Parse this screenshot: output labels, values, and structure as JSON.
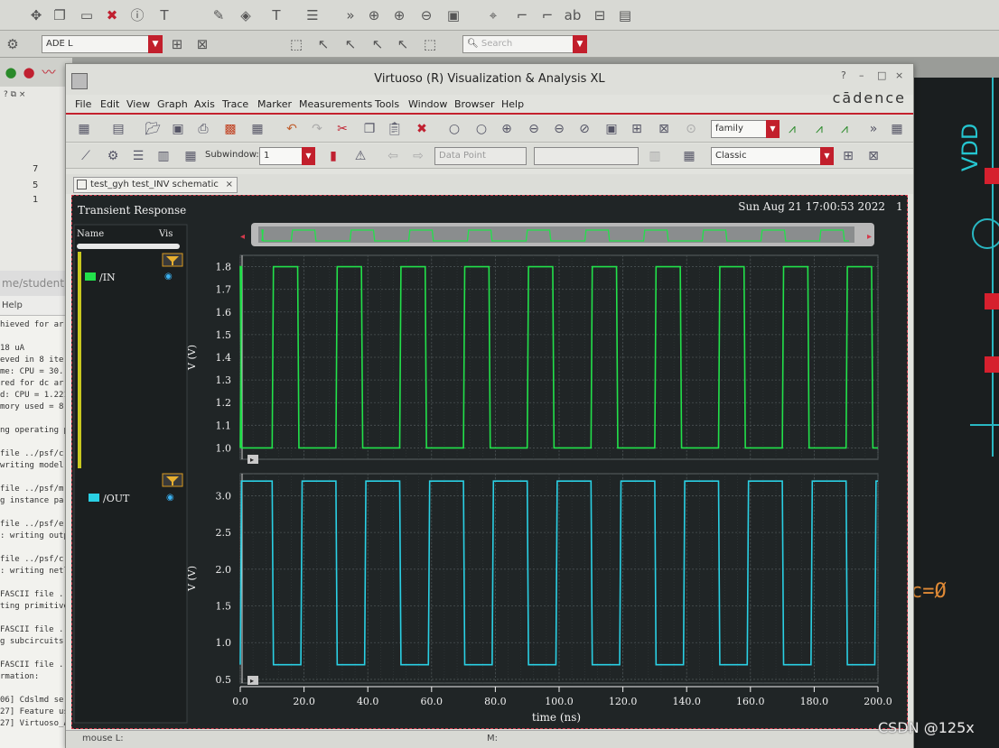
{
  "outer": {
    "session_select": "ADE L",
    "search_placeholder": "Search",
    "left_numbers": [
      "7",
      "5",
      "1"
    ],
    "terminal_header": "me/student",
    "terminal_menu": "Help",
    "terminal_lines": [
      "hieved for ar",
      "",
      "18 uA",
      "eved in 8 ite",
      "me: CPU = 30.",
      "red for dc ar",
      "d: CPU = 1.221",
      "mory used = 8",
      "",
      "ng operating p",
      "",
      " file ../psf/c",
      " writing model",
      "",
      " file ../psf/m",
      "g instance par",
      "",
      " file ../psf/e",
      ": writing outp",
      "",
      " file ../psf/c",
      ": writing netl",
      "",
      "FASCII file ../",
      "ting primitive",
      "",
      "FASCII file ../",
      "g subcircuits",
      "",
      "FASCII file ../",
      "rmation:",
      "",
      "06] Cdslmd serv",
      "27] Feature usa",
      "27] Virtuoso_Ad"
    ],
    "vdd_label": "VDD",
    "c0_label": "c=Ø",
    "watermark": "CSDN @125x"
  },
  "window": {
    "title": "Virtuoso (R) Visualization & Analysis XL",
    "brand": "cādence",
    "menu": [
      "File",
      "Edit",
      "View",
      "Graph",
      "Axis",
      "Trace",
      "Marker",
      "Measurements",
      "Tools",
      "Window",
      "Browser",
      "Help"
    ],
    "family_select": "family",
    "subwindow_label": "Subwindow:",
    "subwindow_value": "1",
    "data_point_placeholder": "Data Point",
    "style_select": "Classic",
    "tab_label": "test_gyh test_INV schematic",
    "status_mouse": "mouse L:",
    "status_m": "M:"
  },
  "plot": {
    "title": "Transient Response",
    "timestamp": "Sun Aug 21 17:00:53 2022",
    "timestamp_suffix": "1",
    "legend_header_name": "Name",
    "legend_header_vis": "Vis",
    "signals": [
      {
        "name": "/IN",
        "color": "#22e14a"
      },
      {
        "name": "/OUT",
        "color": "#2ad0e4"
      }
    ],
    "colors": {
      "in": "#22e14a",
      "out": "#2ad0e4",
      "background": "#202526",
      "grid": "#4a5153",
      "frame_border": "#d43a4c"
    }
  },
  "chart_data": [
    {
      "type": "line",
      "title": "Transient Response",
      "series": [
        {
          "name": "/IN"
        }
      ],
      "xlabel": "time (ns)",
      "ylabel": "V (V)",
      "xlim": [
        0,
        200
      ],
      "ylim": [
        0.95,
        1.85
      ],
      "x_ticks": [
        "0.0",
        "20.0",
        "40.0",
        "60.0",
        "80.0",
        "100.0",
        "120.0",
        "140.0",
        "160.0",
        "180.0",
        "200.0"
      ],
      "y_ticks": [
        "1.0",
        "1.1",
        "1.2",
        "1.3",
        "1.4",
        "1.5",
        "1.6",
        "1.7",
        "1.8"
      ],
      "waveform": {
        "kind": "square",
        "low": 1.0,
        "high": 1.8,
        "rise_times_ns": [
          -1,
          10,
          30,
          50,
          70,
          90,
          110,
          130,
          150,
          170,
          190
        ],
        "fall_times_ns": [
          0,
          18,
          38,
          58,
          78,
          98,
          118,
          138,
          158,
          178,
          198
        ],
        "end_ns": 200
      }
    },
    {
      "type": "line",
      "series": [
        {
          "name": "/OUT"
        }
      ],
      "xlabel": "time (ns)",
      "ylabel": "V (V)",
      "xlim": [
        0,
        200
      ],
      "ylim": [
        0.45,
        3.3
      ],
      "x_ticks": [
        "0.0",
        "20.0",
        "40.0",
        "60.0",
        "80.0",
        "100.0",
        "120.0",
        "140.0",
        "160.0",
        "180.0",
        "200.0"
      ],
      "y_ticks": [
        "0.5",
        "1.0",
        "1.5",
        "2.0",
        "2.5",
        "3.0"
      ],
      "waveform": {
        "kind": "square",
        "low": 0.7,
        "high": 3.2,
        "rise_times_ns": [
          -1,
          19,
          39,
          59,
          79,
          99,
          119,
          139,
          159,
          179,
          199
        ],
        "fall_times_ns": [
          10,
          30,
          50,
          70,
          90,
          110,
          130,
          150,
          170,
          190
        ],
        "end_ns": 200
      }
    }
  ]
}
